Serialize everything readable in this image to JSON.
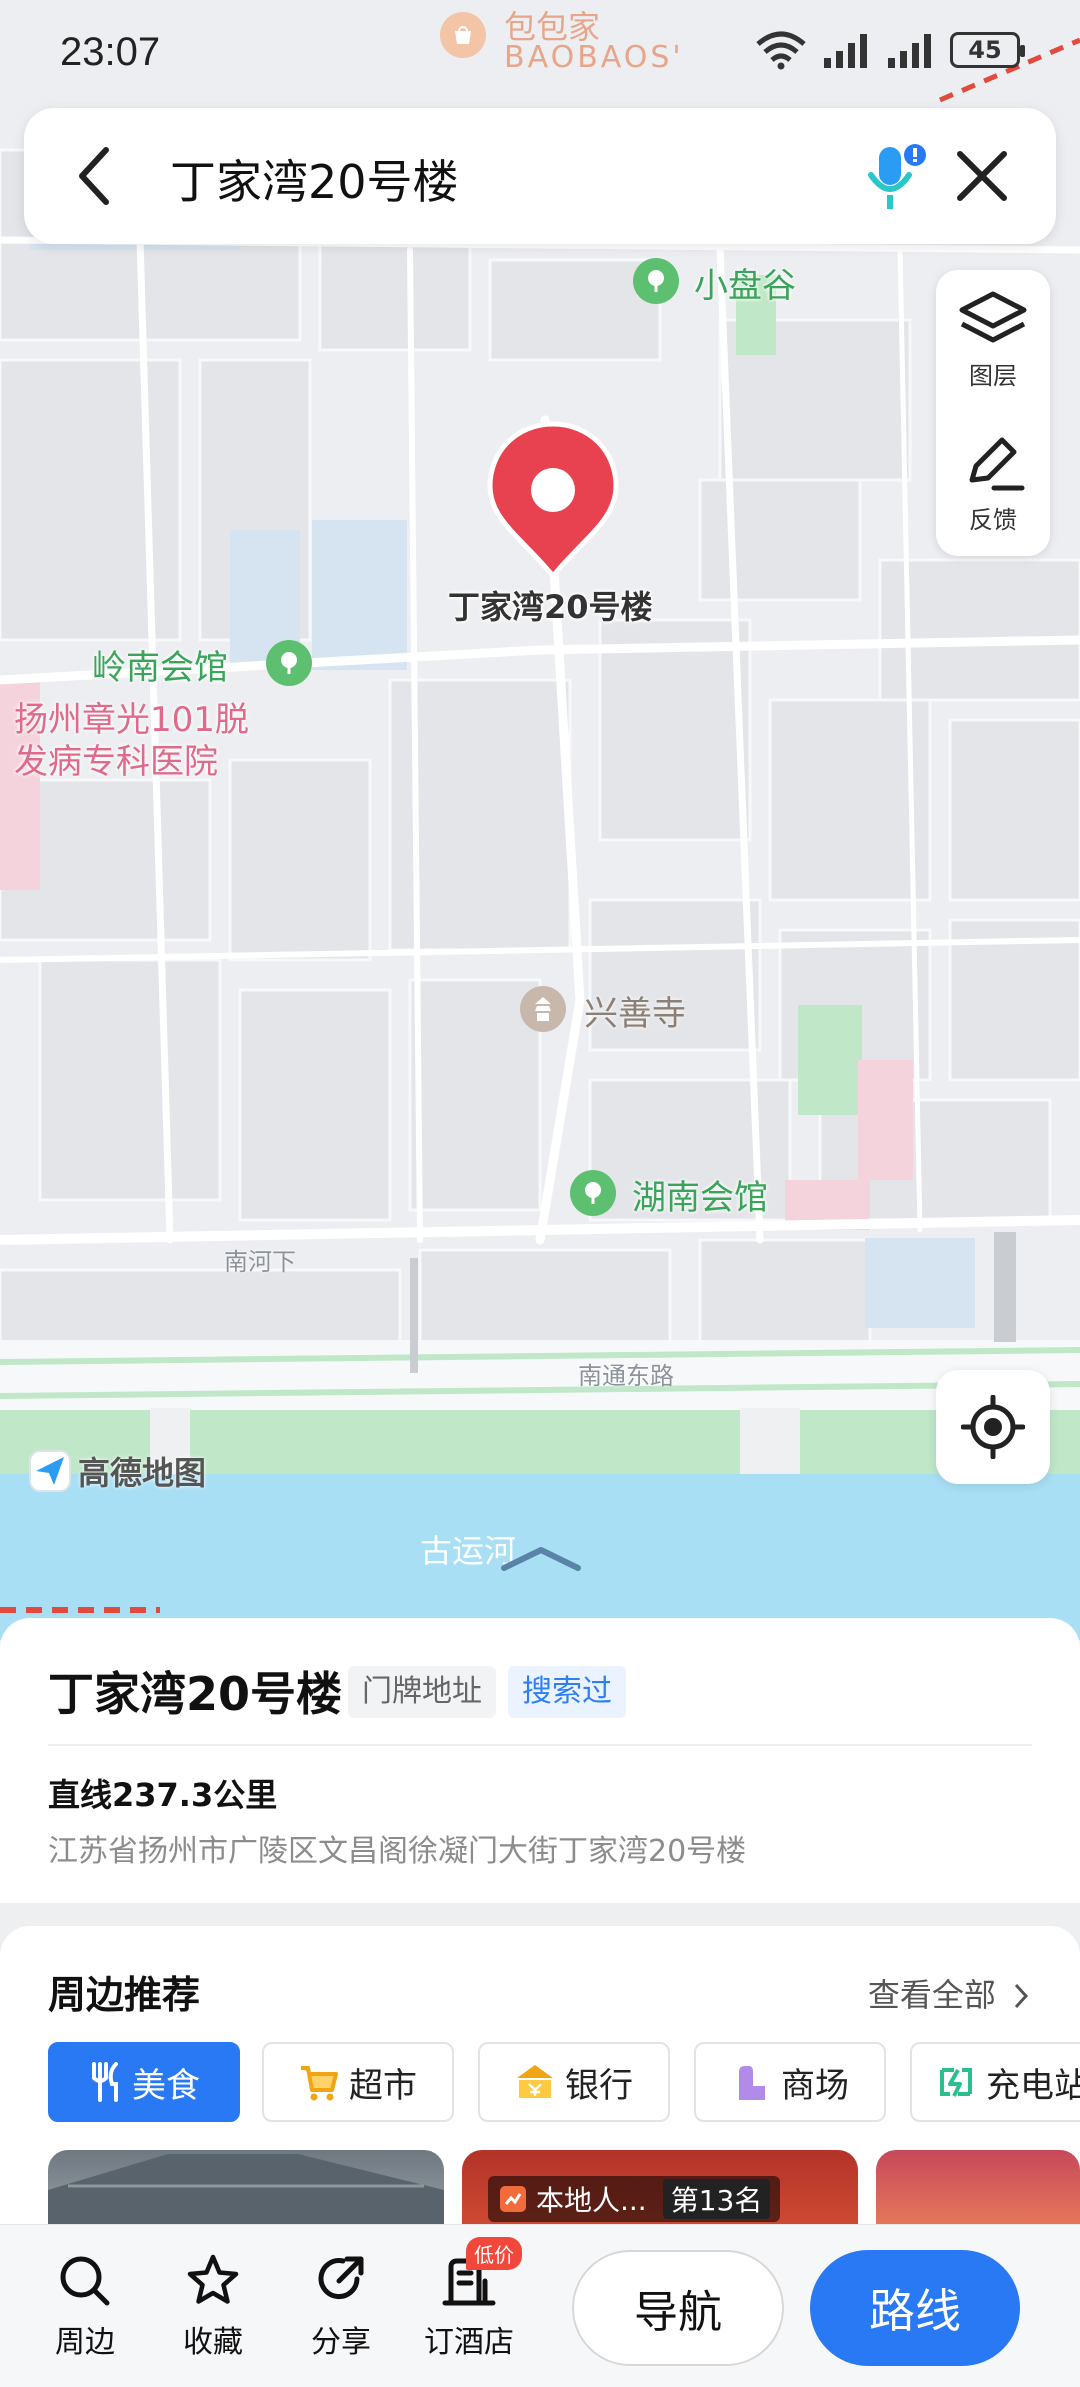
{
  "status_bar": {
    "time": "23:07",
    "battery": "45"
  },
  "search": {
    "query": "丁家湾20号楼"
  },
  "map": {
    "marker_label": "丁家湾20号楼",
    "labels": {
      "top_shop": "包包家",
      "top_shop_en": "BAOBAOS'",
      "xiaopangu": "小盘谷",
      "lingnan": "岭南会馆",
      "hospital_line1": "扬州章光101脱",
      "hospital_line2": "发病专科医院",
      "xingshan": "兴善寺",
      "hunan": "湖南会馆",
      "nanhexia": "南河下",
      "nantong_road": "南通东路",
      "canal": "古运河"
    },
    "logo_text": "高德地图",
    "tools": {
      "layers": "图层",
      "feedback": "反馈"
    }
  },
  "place": {
    "title": "丁家湾20号楼",
    "tag_type": "门牌地址",
    "tag_searched": "搜索过",
    "distance": "直线237.3公里",
    "address": "江苏省扬州市广陵区文昌阁徐凝门大街丁家湾20号楼"
  },
  "nearby": {
    "title": "周边推荐",
    "see_all": "查看全部",
    "chips": [
      "美食",
      "超市",
      "银行",
      "商场",
      "充电站"
    ],
    "card_badge": "本地人...",
    "card_rank": "第13名"
  },
  "bottom_nav": {
    "items": [
      "周边",
      "收藏",
      "分享",
      "订酒店"
    ],
    "hotel_badge": "低价",
    "navigate": "导航",
    "route": "路线"
  },
  "colors": {
    "accent": "#2a79f4",
    "marker": "#e8414f",
    "river": "#a8dff4",
    "park": "#bfe7c8"
  }
}
